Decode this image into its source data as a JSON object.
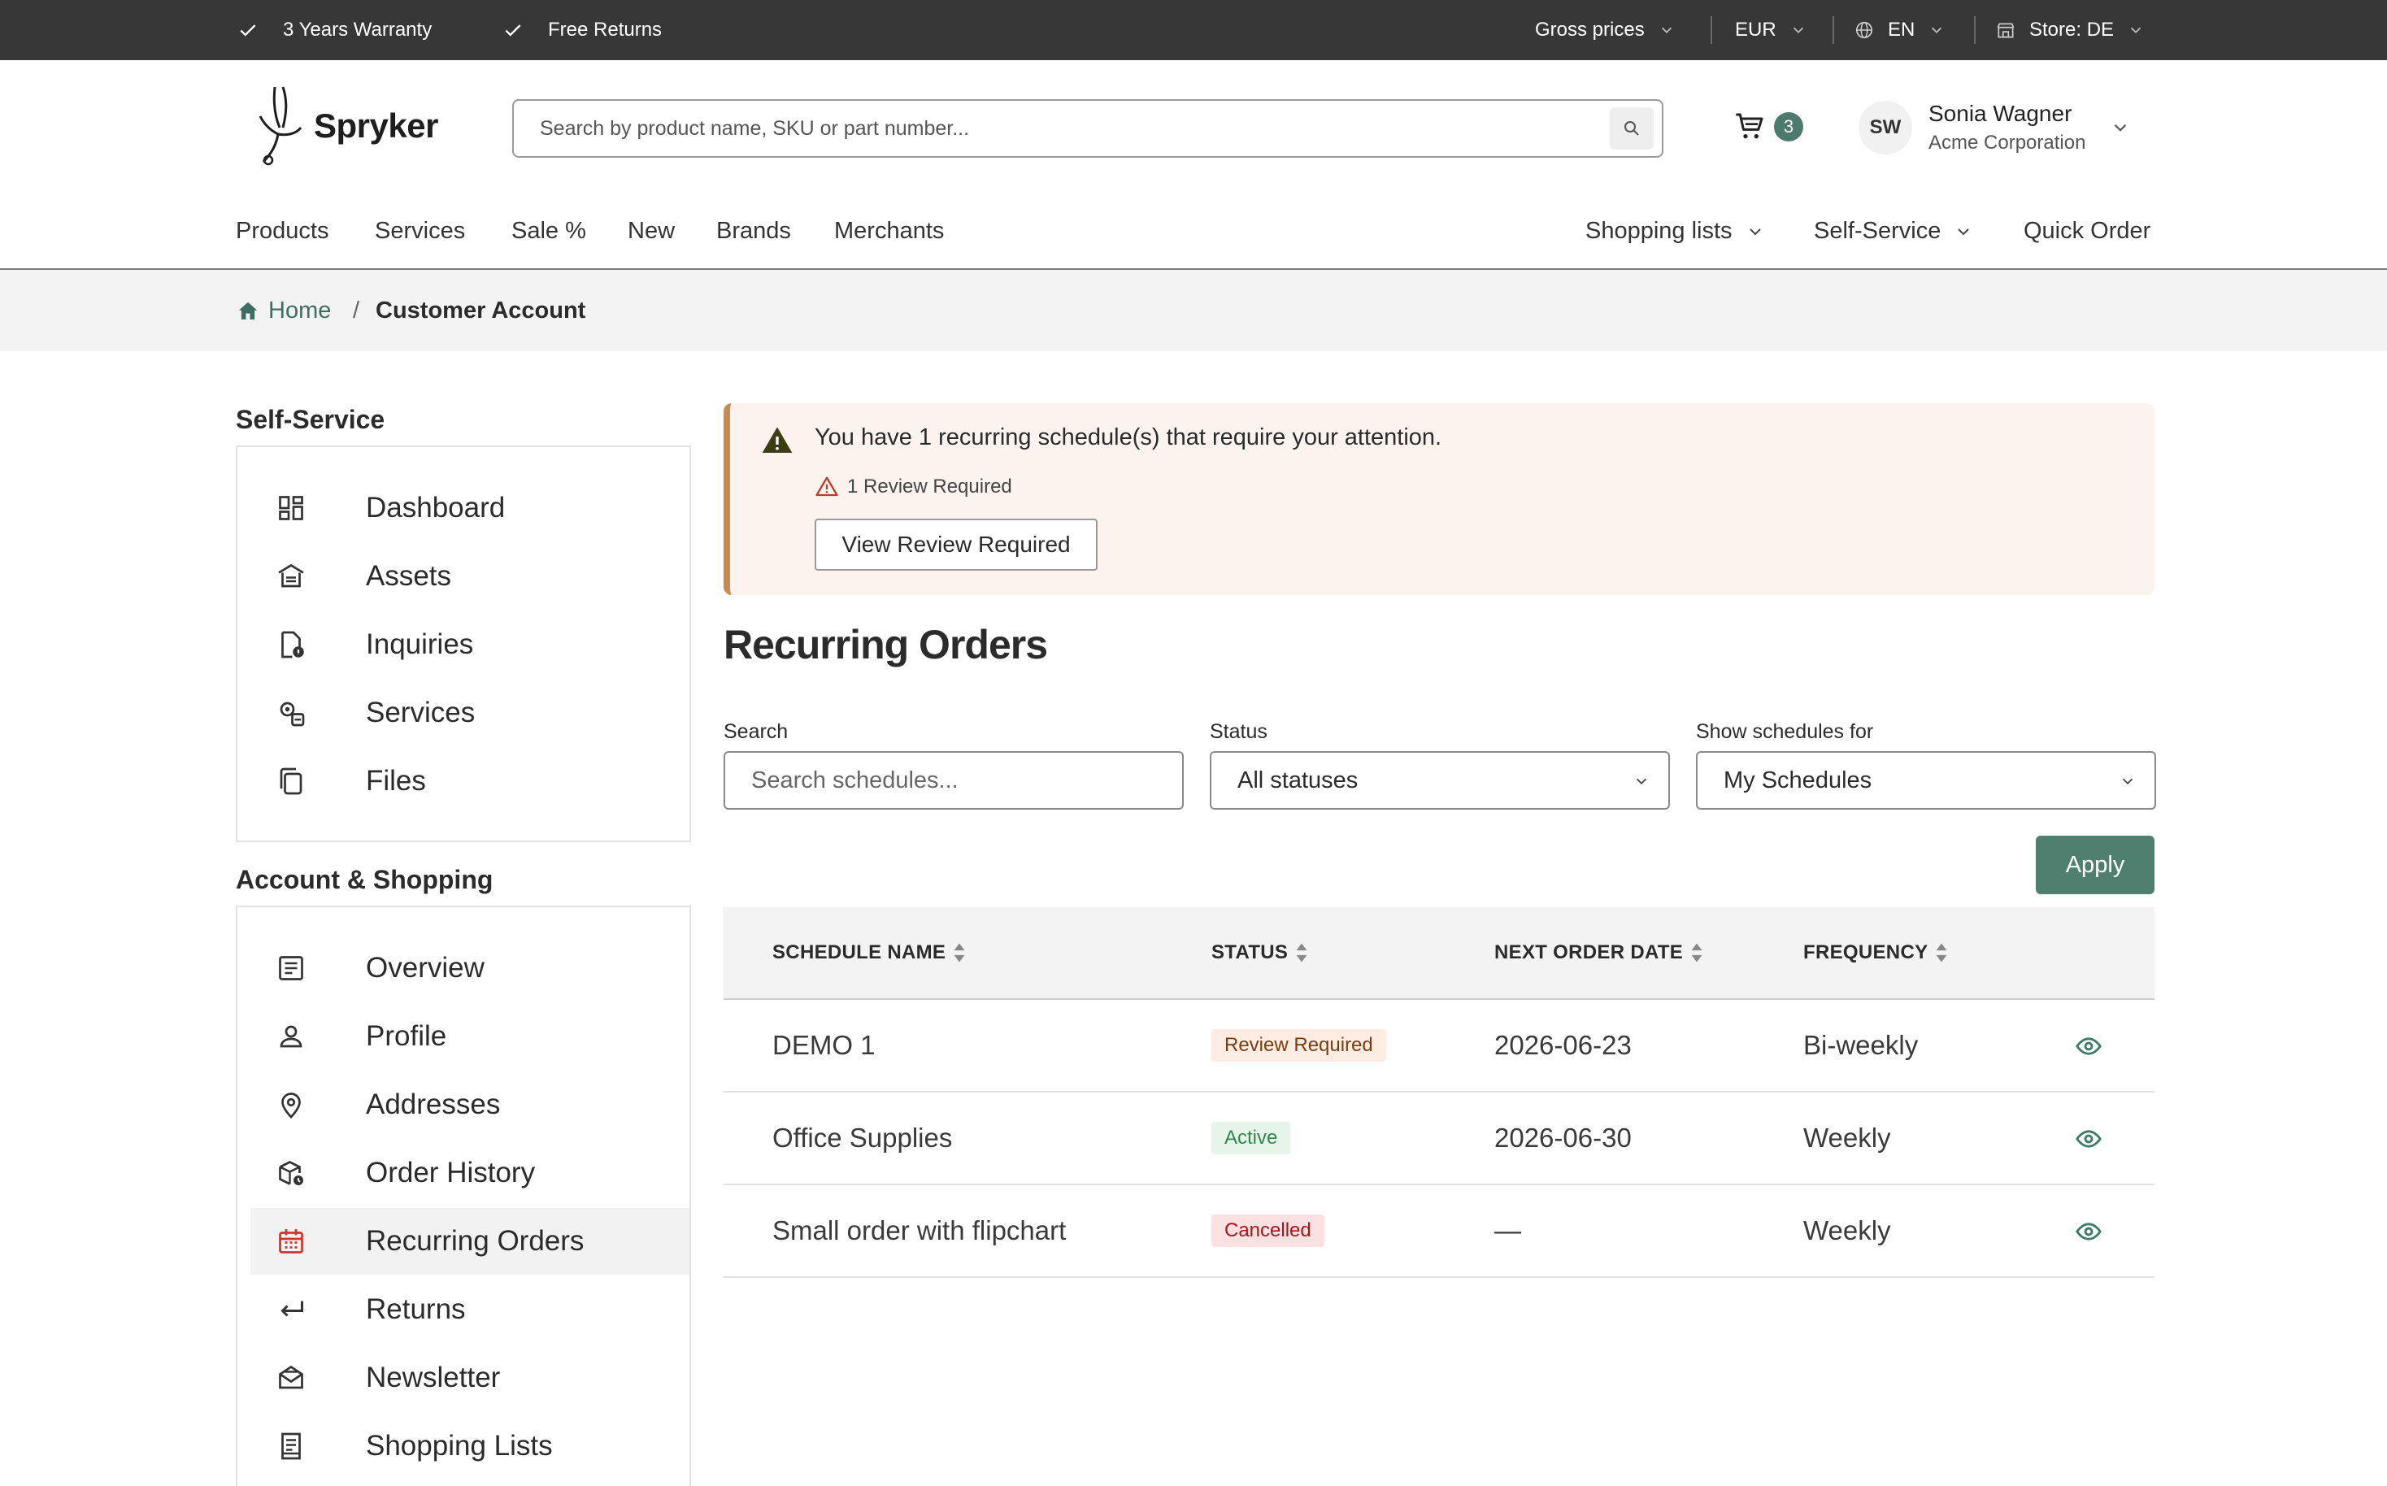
{
  "topbar": {
    "usps": [
      "3 Years Warranty",
      "Free Returns"
    ],
    "price_mode": "Gross prices",
    "currency": "EUR",
    "language": "EN",
    "store": "Store: DE"
  },
  "header": {
    "logo_text": "Spryker",
    "search_placeholder": "Search by product name, SKU or part number...",
    "cart_count": "3",
    "user": {
      "initials": "SW",
      "name": "Sonia Wagner",
      "company": "Acme Corporation"
    }
  },
  "nav": {
    "left": [
      "Products",
      "Services",
      "Sale %",
      "New",
      "Brands",
      "Merchants"
    ],
    "right": [
      "Shopping lists",
      "Self-Service",
      "Quick Order"
    ]
  },
  "breadcrumb": {
    "home": "Home",
    "separator": "/",
    "current": "Customer Account"
  },
  "sidebar": {
    "self_service_heading": "Self-Service",
    "self_service_items": [
      {
        "label": "Dashboard",
        "icon": "dashboard-icon"
      },
      {
        "label": "Assets",
        "icon": "assets-icon"
      },
      {
        "label": "Inquiries",
        "icon": "inquiries-icon"
      },
      {
        "label": "Services",
        "icon": "services-icon"
      },
      {
        "label": "Files",
        "icon": "files-icon"
      }
    ],
    "account_heading": "Account & Shopping",
    "account_items": [
      {
        "label": "Overview",
        "icon": "overview-icon"
      },
      {
        "label": "Profile",
        "icon": "profile-icon"
      },
      {
        "label": "Addresses",
        "icon": "location-pin-icon"
      },
      {
        "label": "Order History",
        "icon": "order-history-icon"
      },
      {
        "label": "Recurring Orders",
        "icon": "calendar-icon",
        "active": true
      },
      {
        "label": "Returns",
        "icon": "return-arrow-icon"
      },
      {
        "label": "Newsletter",
        "icon": "newsletter-icon"
      },
      {
        "label": "Shopping Lists",
        "icon": "shopping-list-icon"
      }
    ]
  },
  "alert": {
    "message": "You have 1 recurring schedule(s) that require your attention.",
    "sub": "1 Review Required",
    "button": "View Review Required"
  },
  "page": {
    "title": "Recurring Orders"
  },
  "filters": {
    "search_label": "Search",
    "search_placeholder": "Search schedules...",
    "status_label": "Status",
    "status_value": "All statuses",
    "show_label": "Show schedules for",
    "show_value": "My Schedules",
    "apply": "Apply"
  },
  "table": {
    "columns": [
      "SCHEDULE NAME",
      "STATUS",
      "NEXT ORDER DATE",
      "FREQUENCY"
    ],
    "rows": [
      {
        "name": "DEMO 1",
        "status": "Review Required",
        "status_kind": "review",
        "next": "2026-06-23",
        "frequency": "Bi-weekly"
      },
      {
        "name": "Office Supplies",
        "status": "Active",
        "status_kind": "active",
        "next": "2026-06-30",
        "frequency": "Weekly"
      },
      {
        "name": "Small order with flipchart",
        "status": "Cancelled",
        "status_kind": "cancelled",
        "next": "—",
        "frequency": "Weekly"
      }
    ]
  },
  "colors": {
    "topbar_bg": "#373737",
    "accent_green": "#4f7f6f",
    "alert_bg": "#fdf3ee",
    "alert_border": "#c58b55",
    "active_nav_icon": "#d0342c"
  }
}
